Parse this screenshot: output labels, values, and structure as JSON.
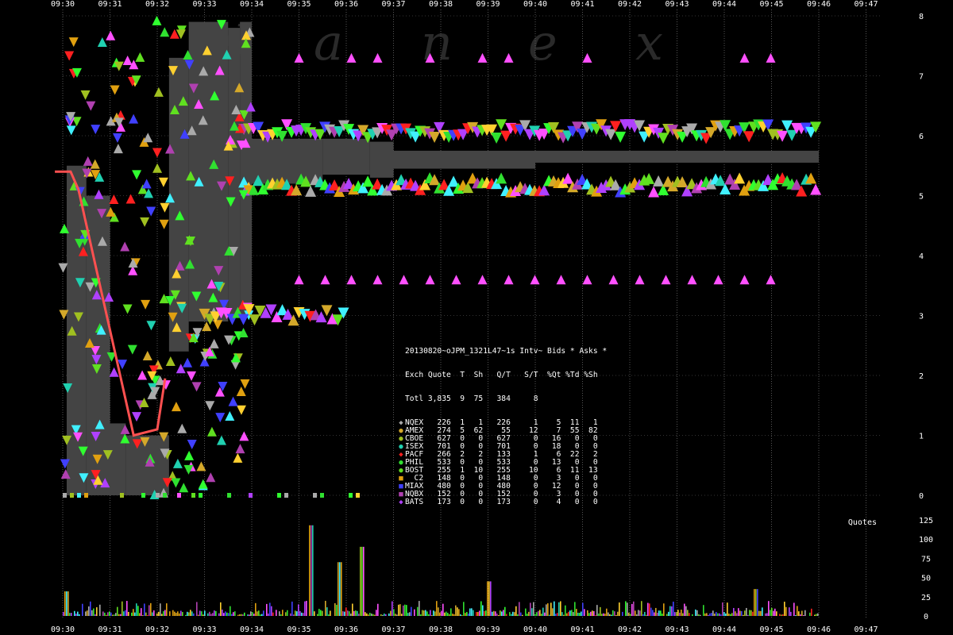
{
  "chart_data": {
    "type": "scatter",
    "watermark": "N a n e x",
    "x_ticks": [
      "09:30",
      "09:31",
      "09:32",
      "09:33",
      "09:34",
      "09:35",
      "09:36",
      "09:37",
      "09:38",
      "09:39",
      "09:40",
      "09:41",
      "09:42",
      "09:43",
      "09:44",
      "09:45",
      "09:46",
      "09:47"
    ],
    "price_axis": {
      "ylim": [
        0,
        8
      ],
      "ticks": [
        "0",
        "1",
        "2",
        "3",
        "4",
        "5",
        "6",
        "7",
        "8"
      ]
    },
    "volume_axis": {
      "label": "Quotes",
      "ylim": [
        0,
        125
      ],
      "ticks": [
        "0",
        "25",
        "50",
        "75",
        "100",
        "125"
      ]
    },
    "exchange_colors": {
      "NQEX": "#aaaaaa",
      "AMEX": "#d4a82a",
      "CBOE": "#a0c020",
      "ISEX": "#20d0b0",
      "PACF": "#ff2020",
      "PHIL": "#30e030",
      "BOST": "#60e020",
      "C2": "#e0a010",
      "MIAX": "#4040ff",
      "NQBX": "#b040b0",
      "BATS": "#b040ff"
    },
    "bid_ask_spread": [
      {
        "t": "09:30:05",
        "low": 0.0,
        "high": 5.5
      },
      {
        "t": "09:30:30",
        "low": 0.0,
        "high": 5.0
      },
      {
        "t": "09:31:00",
        "low": 0.0,
        "high": 1.2
      },
      {
        "t": "09:31:20",
        "low": 0.0,
        "high": 1.0
      },
      {
        "t": "09:32:15",
        "low": 2.4,
        "high": 7.3
      },
      {
        "t": "09:32:40",
        "low": 2.9,
        "high": 7.9
      },
      {
        "t": "09:33:30",
        "low": 3.0,
        "high": 7.8
      },
      {
        "t": "09:33:45",
        "low": 3.0,
        "high": 7.9
      },
      {
        "t": "09:34:00",
        "low": 5.2,
        "high": 5.95
      },
      {
        "t": "09:35:30",
        "low": 5.35,
        "high": 5.95
      },
      {
        "t": "09:36:30",
        "low": 5.3,
        "high": 5.9
      },
      {
        "t": "09:37:00",
        "low": 5.45,
        "high": 5.75
      },
      {
        "t": "09:40:00",
        "low": 5.55,
        "high": 5.75
      },
      {
        "t": "09:46:00",
        "low": 5.55,
        "high": 5.75
      }
    ],
    "nbbo_line": [
      {
        "t": "09:29:50",
        "price": 5.4
      },
      {
        "t": "09:30:10",
        "price": 5.4
      },
      {
        "t": "09:30:20",
        "price": 5.1
      },
      {
        "t": "09:31:30",
        "price": 1.0
      },
      {
        "t": "09:32:00",
        "price": 1.1
      },
      {
        "t": "09:32:10",
        "price": 1.95
      }
    ],
    "legend": {
      "title": "20130820~oJPM_1321L47~1s Intv~ Bids * Asks *",
      "header": "Exch Quote  T  Sh   Q/T   S/T  %Qt %Td %Sh",
      "total": "Totl 3,835  9  75   384     8",
      "rows": [
        {
          "exch": "NQEX",
          "marker": "◆",
          "color": "#aaaaaa",
          "text": "NQEX   226  1   1   226     1    5  11   1"
        },
        {
          "exch": "AMEX",
          "marker": "●",
          "color": "#d4a82a",
          "text": "AMEX   274  5  62    55    12    7  55  82"
        },
        {
          "exch": "CBOE",
          "marker": "●",
          "color": "#a0c020",
          "text": "CBOE   627  0   0   627     0   16   0   0"
        },
        {
          "exch": "ISEX",
          "marker": "●",
          "color": "#20d0b0",
          "text": "ISEX   701  0   0   701     0   18   0   0"
        },
        {
          "exch": "PACF",
          "marker": "◆",
          "color": "#ff2020",
          "text": "PACF   266  2   2   133     1    6  22   2"
        },
        {
          "exch": "PHIL",
          "marker": "●",
          "color": "#30e030",
          "text": "PHIL   533  0   0   533     0   13   0   0"
        },
        {
          "exch": "BOST",
          "marker": "●",
          "color": "#60e020",
          "text": "BOST   255  1  10   255    10    6  11  13"
        },
        {
          "exch": "C2",
          "marker": "■",
          "color": "#e0a010",
          "text": "  C2   148  0   0   148     0    3   0   0"
        },
        {
          "exch": "MIAX",
          "marker": "■",
          "color": "#4040ff",
          "text": "MIAX   480  0   0   480     0   12   0   0"
        },
        {
          "exch": "NQBX",
          "marker": "■",
          "color": "#b040b0",
          "text": "NQBX   152  0   0   152     0    3   0   0"
        },
        {
          "exch": "BATS",
          "marker": "◆",
          "color": "#b040ff",
          "text": "BATS   173  0   0   173     0    4   0   0"
        }
      ]
    },
    "grid": true
  }
}
